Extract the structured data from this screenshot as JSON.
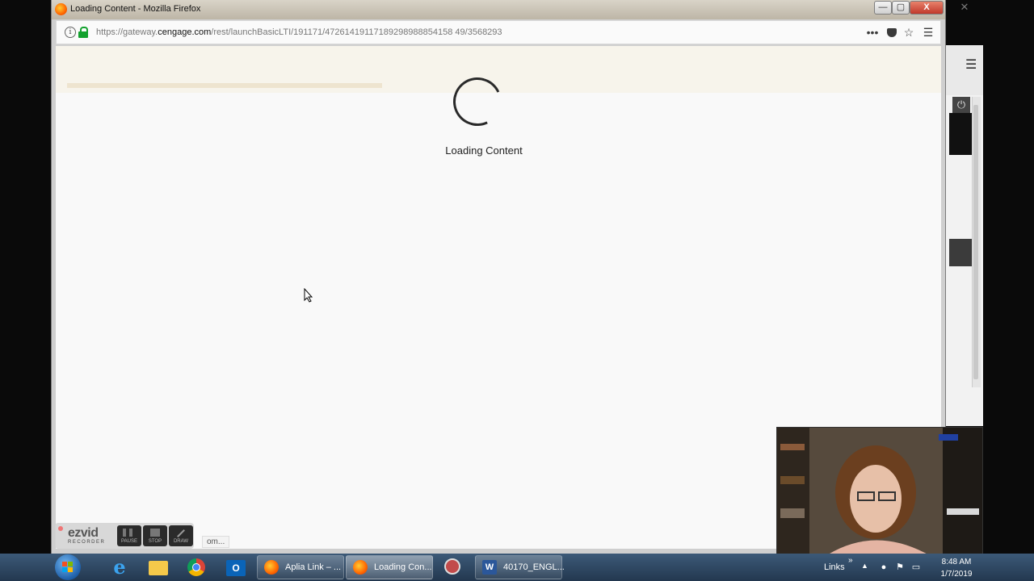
{
  "window": {
    "title": "Loading Content - Mozilla Firefox",
    "buttons": {
      "minimize": "—",
      "maximize": "▢",
      "close": "X"
    }
  },
  "navbar": {
    "url_prefix": "https://gateway.",
    "url_domain": "cengage.com",
    "url_path": "/rest/launchBasicLTI/191171/47261419117189298988854158 49/3568293",
    "icons": [
      "page-actions-icon",
      "pocket-icon",
      "bookmark-star-icon",
      "menu-icon"
    ]
  },
  "content": {
    "loading_text": "Loading Content",
    "status_fragment": "om..."
  },
  "background_window": {
    "menu_glyph": "☰",
    "power_glyph": "⏻",
    "close_glyph": "✕"
  },
  "recorder": {
    "logo": "ezvid",
    "subtitle": "RECORDER",
    "buttons": [
      "PAUSE",
      "STOP",
      "DRAW"
    ]
  },
  "taskbar": {
    "tasks": [
      {
        "label": "Aplia Link – ...",
        "icon": "firefox-icon"
      },
      {
        "label": "Loading Con...",
        "icon": "firefox-icon",
        "active": true
      },
      {
        "label": "40170_ENGL...",
        "icon": "word-icon"
      }
    ],
    "pinned": [
      "start-icon",
      "internet-explorer-icon",
      "file-explorer-icon",
      "chrome-icon",
      "outlook-icon",
      "snipping-tool-icon"
    ],
    "tray": {
      "links_label": "Links",
      "time": "8:48 AM",
      "date": "1/7/2019"
    }
  },
  "colors": {
    "lock_green": "#13a12e",
    "taskbar_blue": "#2f4a66"
  }
}
